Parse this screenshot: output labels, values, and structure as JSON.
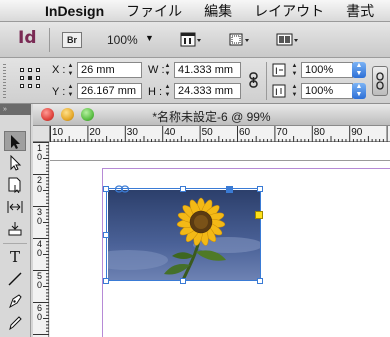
{
  "menubar": {
    "items": [
      "InDesign",
      "ファイル",
      "編集",
      "レイアウト",
      "書式"
    ]
  },
  "appbar": {
    "app_logo": "Id",
    "bridge_label": "Br",
    "zoom": "100%"
  },
  "control_panel": {
    "x_label": "X :",
    "x_value": "26 mm",
    "y_label": "Y :",
    "y_value": "26.167 mm",
    "w_label": "W :",
    "w_value": "41.333 mm",
    "h_label": "H :",
    "h_value": "24.333 mm",
    "scale_x": "100%",
    "scale_y": "100%"
  },
  "document": {
    "title": "*名称未設定-6 @ 99%"
  },
  "rulers": {
    "horizontal": [
      "10",
      "20",
      "30",
      "40",
      "50",
      "60",
      "70",
      "80",
      "90"
    ],
    "vertical": [
      "10",
      "20",
      "30",
      "40",
      "50",
      "60"
    ]
  },
  "colors": {
    "selection": "#3a7bd5",
    "margin_guide": "#b68ad6",
    "close_button": "#e0443e",
    "minimize_button": "#e6a92b",
    "zoom_button": "#5cbf45"
  }
}
